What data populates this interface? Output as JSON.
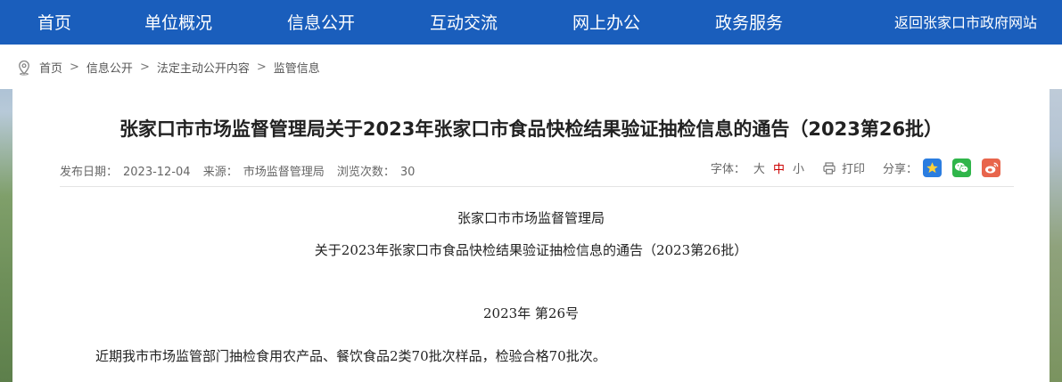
{
  "nav": {
    "items": [
      "首页",
      "单位概况",
      "信息公开",
      "互动交流",
      "网上办公",
      "政务服务"
    ],
    "right_link": "返回张家口市政府网站"
  },
  "breadcrumb": [
    "首页",
    "信息公开",
    "法定主动公开内容",
    "监管信息"
  ],
  "article": {
    "title": "张家口市市场监督管理局关于2023年张家口市食品快检结果验证抽检信息的通告（2023第26批）",
    "meta": {
      "date_label": "发布日期：",
      "date": "2023-12-04",
      "source_label": "来源：",
      "source": "市场监督管理局",
      "views_label": "浏览次数：",
      "views": "30"
    },
    "tools": {
      "font_label": "字体：",
      "font_large": "大",
      "font_medium": "中",
      "font_small": "小",
      "print": "打印",
      "share_label": "分享："
    },
    "body": {
      "org": "张家口市市场监督管理局",
      "subtitle": "关于2023年张家口市食品快检结果验证抽检信息的通告（2023第26批）",
      "number": "2023年  第26号",
      "paragraph": "近期我市市场监管部门抽检食用农产品、餐饮食品2类70批次样品，检验合格70批次。"
    }
  },
  "colors": {
    "nav_bg": "#1a5ebc",
    "share_qzone": "#2b7de0",
    "share_wechat": "#2fb54a",
    "share_weibo": "#e8654c"
  }
}
